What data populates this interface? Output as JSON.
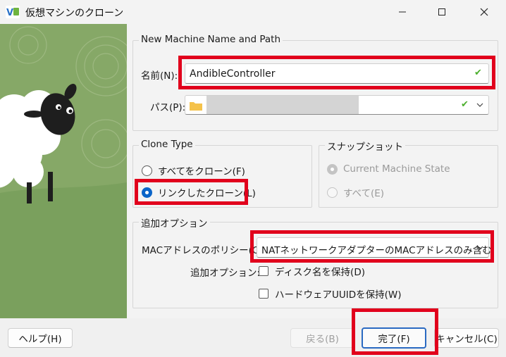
{
  "window": {
    "title": "仮想マシンのクローン"
  },
  "name_group": {
    "title": "New Machine Name and Path",
    "name_label": "名前(N):",
    "name_value": "AndibleController",
    "path_label": "パス(P):"
  },
  "clone_type": {
    "title": "Clone Type",
    "options": [
      {
        "label": "すべてをクローン(F)",
        "selected": false
      },
      {
        "label": "リンクしたクローン(L)",
        "selected": true
      }
    ]
  },
  "snapshot": {
    "title": "スナップショット",
    "options": [
      {
        "label": "Current Machine State",
        "selected": true
      },
      {
        "label": "すべて(E)",
        "selected": false
      }
    ]
  },
  "options_group": {
    "title": "追加オプション",
    "mac_label": "MACアドレスのポリシー(O):",
    "mac_value": "NATネットワークアダプターのMACアドレスのみ含む",
    "extra_label": "追加オプション:",
    "keep_disk_names": "ディスク名を保持(D)",
    "keep_hw_uuids": "ハードウェアUUIDを保持(W)"
  },
  "buttons": {
    "help": "ヘルプ(H)",
    "back": "戻る(B)",
    "finish": "完了(F)",
    "cancel": "キャンセル(C)"
  },
  "colors": {
    "accent": "#0a64c8",
    "highlight": "#e1001c",
    "valid": "#4caf2d",
    "art_green": "#86a867"
  }
}
